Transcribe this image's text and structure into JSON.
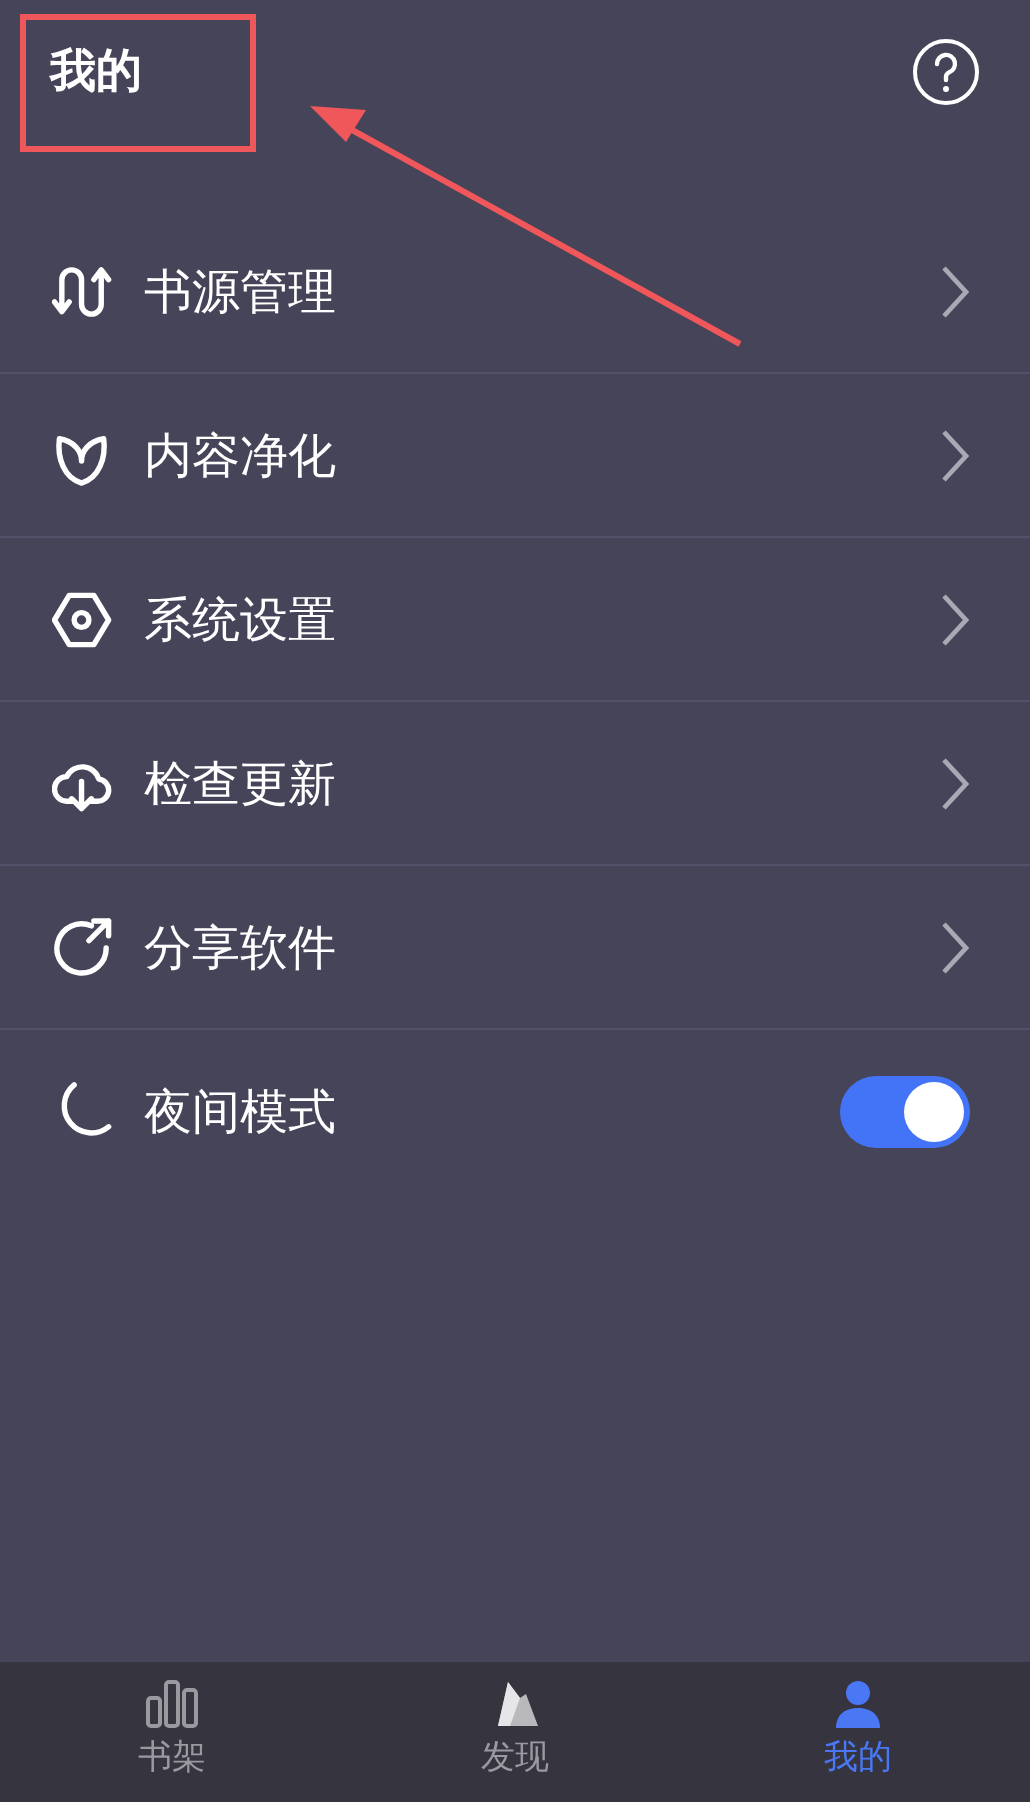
{
  "header": {
    "title": "我的",
    "annotation": {
      "kind": "box-arrow"
    }
  },
  "menu": [
    {
      "kind": "link",
      "label": "书源管理"
    },
    {
      "kind": "link",
      "label": "内容净化"
    },
    {
      "kind": "link",
      "label": "系统设置"
    },
    {
      "kind": "link",
      "label": "检查更新"
    },
    {
      "kind": "link",
      "label": "分享软件"
    },
    {
      "kind": "toggle",
      "label": "夜间模式",
      "on": true
    }
  ],
  "tab_bar": [
    {
      "label": "书架",
      "selected": false
    },
    {
      "label": "发现",
      "selected": false
    },
    {
      "label": "我的",
      "selected": true
    }
  ]
}
